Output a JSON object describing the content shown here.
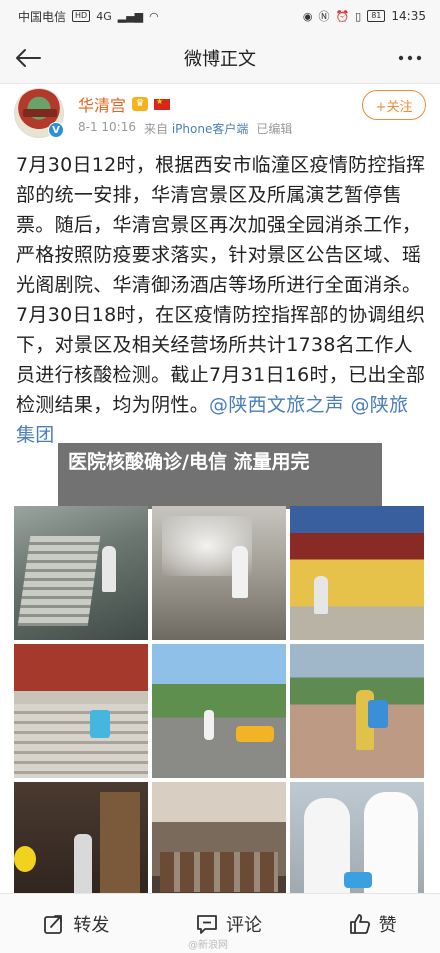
{
  "status_bar": {
    "carrier": "中国电信",
    "network_badge": "HD",
    "network_type": "4G",
    "battery": "81",
    "time": "14:35"
  },
  "nav": {
    "title": "微博正文",
    "back_icon": "back-arrow-icon",
    "more_icon": "more-icon"
  },
  "author": {
    "name": "华清宫",
    "date": "8-1 10:16",
    "source_prefix": "来自",
    "source_client": "iPhone客户端",
    "edited": "已编辑",
    "follow_label": "+关注",
    "verified_mark": "V"
  },
  "post": {
    "para1": "7月30日12时，根据西安市临潼区疫情防控指挥部的统一安排，华清宫景区及所属演艺暂停售票。随后，华清宫景区再次加强全园消杀工作，严格按照防疫要求落实，针对景区公告区域、瑶光阁剧院、华清御汤酒店等场所进行全面消杀。",
    "para2_text": "7月30日18时，在区疫情防控指挥部的协调组织下，对景区及相关经营场所共计1738名工作人员进行核酸检测。截止7月31日16时，已出全部检测结果，均为阴性。",
    "mention1": "@陕西文旅之声",
    "mention2": "@陕旅集团"
  },
  "overlay": {
    "headline": "医院核酸确诊/电信 流量用完"
  },
  "toolbar": {
    "repost_label": "转发",
    "comment_label": "评论",
    "like_label": "赞"
  },
  "watermark": "@新浪网"
}
